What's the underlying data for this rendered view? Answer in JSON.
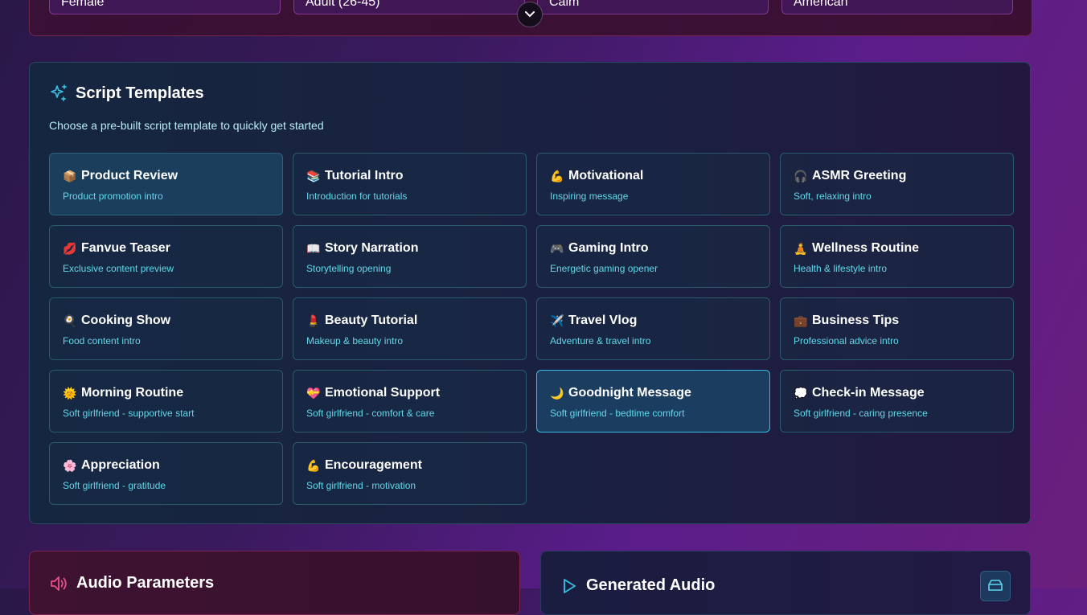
{
  "top_selects": [
    {
      "value": "Female"
    },
    {
      "value": "Adult (26-45)"
    },
    {
      "value": "Calm"
    },
    {
      "value": "American"
    }
  ],
  "templates": {
    "title": "Script Templates",
    "description": "Choose a pre-built script template to quickly get started",
    "items": [
      {
        "emoji": "📦",
        "title": "Product Review",
        "subtitle": "Product promotion intro"
      },
      {
        "emoji": "📚",
        "title": "Tutorial Intro",
        "subtitle": "Introduction for tutorials"
      },
      {
        "emoji": "💪",
        "title": "Motivational",
        "subtitle": "Inspiring message"
      },
      {
        "emoji": "🎧",
        "title": "ASMR Greeting",
        "subtitle": "Soft, relaxing intro"
      },
      {
        "emoji": "💋",
        "title": "Fanvue Teaser",
        "subtitle": "Exclusive content preview"
      },
      {
        "emoji": "📖",
        "title": "Story Narration",
        "subtitle": "Storytelling opening"
      },
      {
        "emoji": "🎮",
        "title": "Gaming Intro",
        "subtitle": "Energetic gaming opener"
      },
      {
        "emoji": "🧘",
        "title": "Wellness Routine",
        "subtitle": "Health & lifestyle intro"
      },
      {
        "emoji": "🍳",
        "title": "Cooking Show",
        "subtitle": "Food content intro"
      },
      {
        "emoji": "💄",
        "title": "Beauty Tutorial",
        "subtitle": "Makeup & beauty intro"
      },
      {
        "emoji": "✈️",
        "title": "Travel Vlog",
        "subtitle": "Adventure & travel intro"
      },
      {
        "emoji": "💼",
        "title": "Business Tips",
        "subtitle": "Professional advice intro"
      },
      {
        "emoji": "🌞",
        "title": "Morning Routine",
        "subtitle": "Soft girlfriend - supportive start"
      },
      {
        "emoji": "💝",
        "title": "Emotional Support",
        "subtitle": "Soft girlfriend - comfort & care"
      },
      {
        "emoji": "🌙",
        "title": "Goodnight Message",
        "subtitle": "Soft girlfriend - bedtime comfort"
      },
      {
        "emoji": "💭",
        "title": "Check-in Message",
        "subtitle": "Soft girlfriend - caring presence"
      },
      {
        "emoji": "🌸",
        "title": "Appreciation",
        "subtitle": "Soft girlfriend - gratitude"
      },
      {
        "emoji": "💪",
        "title": "Encouragement",
        "subtitle": "Soft girlfriend - motivation"
      }
    ]
  },
  "audio_parameters": {
    "title": "Audio Parameters"
  },
  "generated_audio": {
    "title": "Generated Audio"
  },
  "colors": {
    "accent_cyan": "#38bde0",
    "accent_pink": "#e8508a"
  },
  "icons": {
    "templates": "sparkles-icon",
    "audio": "speaker-icon",
    "generated": "play-icon",
    "collapse": "chevron-down-icon"
  }
}
